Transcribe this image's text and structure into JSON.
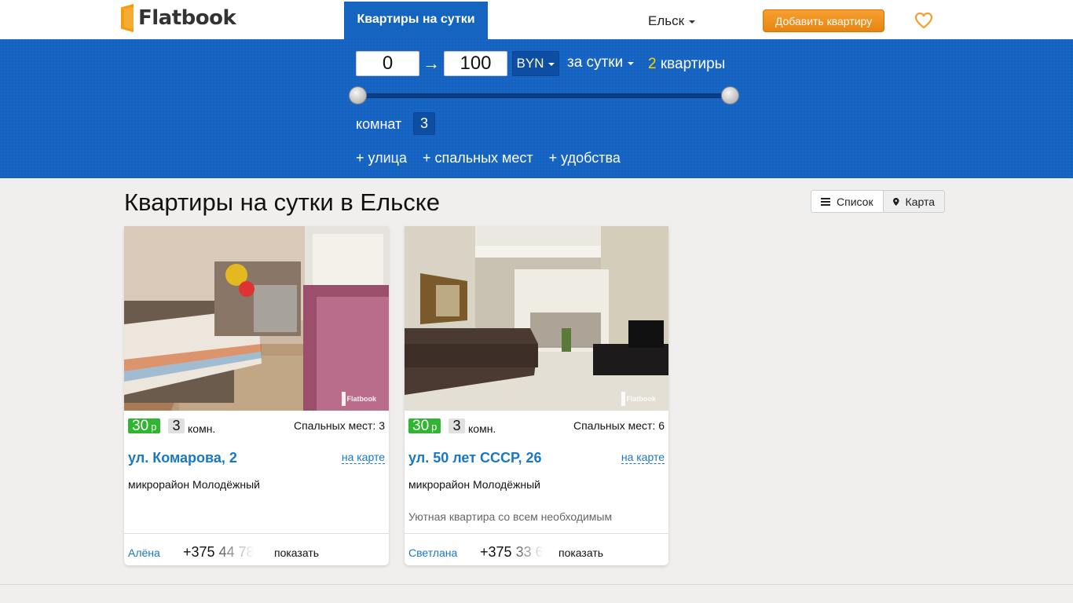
{
  "header": {
    "logo_text": "Flatbook",
    "nav_tab": "Квартиры на сутки",
    "city": "Ельск",
    "add_button": "Добавить квартиру"
  },
  "filter": {
    "price_from": "0",
    "price_to": "100",
    "arrow": "→",
    "currency": "BYN",
    "period": "за сутки",
    "count_number": "2",
    "count_label": "квартиры",
    "slider_min_fraction": 0,
    "slider_max_fraction": 1,
    "rooms_label": "комнат",
    "rooms_value": "3",
    "extras": [
      "+ улица",
      "+ спальных мест",
      "+ удобства"
    ]
  },
  "main": {
    "title": "Квартиры на сутки в Ельске",
    "view_list": "Список",
    "view_map": "Карта"
  },
  "listings": [
    {
      "price": "30",
      "currency_short": "р",
      "rooms": "3",
      "rooms_suffix": "комн.",
      "sleeps": "Спальных мест: 3",
      "address": "ул. Комарова, 2",
      "map_link": "на карте",
      "district": "микрорайон Молодёжный",
      "description": "",
      "owner": "Алёна",
      "phone_visible": "+375",
      "phone_faded": "44 78",
      "show_label": "показать",
      "watermark": "Flatbook"
    },
    {
      "price": "30",
      "currency_short": "р",
      "rooms": "3",
      "rooms_suffix": "комн.",
      "sleeps": "Спальных мест: 6",
      "address": "ул. 50 лет СССР, 26",
      "map_link": "на карте",
      "district": "микрорайон Молодёжный",
      "description": "Уютная квартира со всем необходимым",
      "owner": "Светлана",
      "phone_visible": "+375",
      "phone_faded": "33 6",
      "show_label": "показать",
      "watermark": "Flatbook"
    }
  ],
  "icons": {
    "favorite": "heart-icon",
    "list": "list-icon",
    "map": "map-pin-icon"
  },
  "colors": {
    "brand_blue": "#1462c1",
    "accent_orange": "#e8850f",
    "price_green": "#2fb52f",
    "link_blue": "#1a78c2",
    "count_yellow": "#f5d400"
  }
}
